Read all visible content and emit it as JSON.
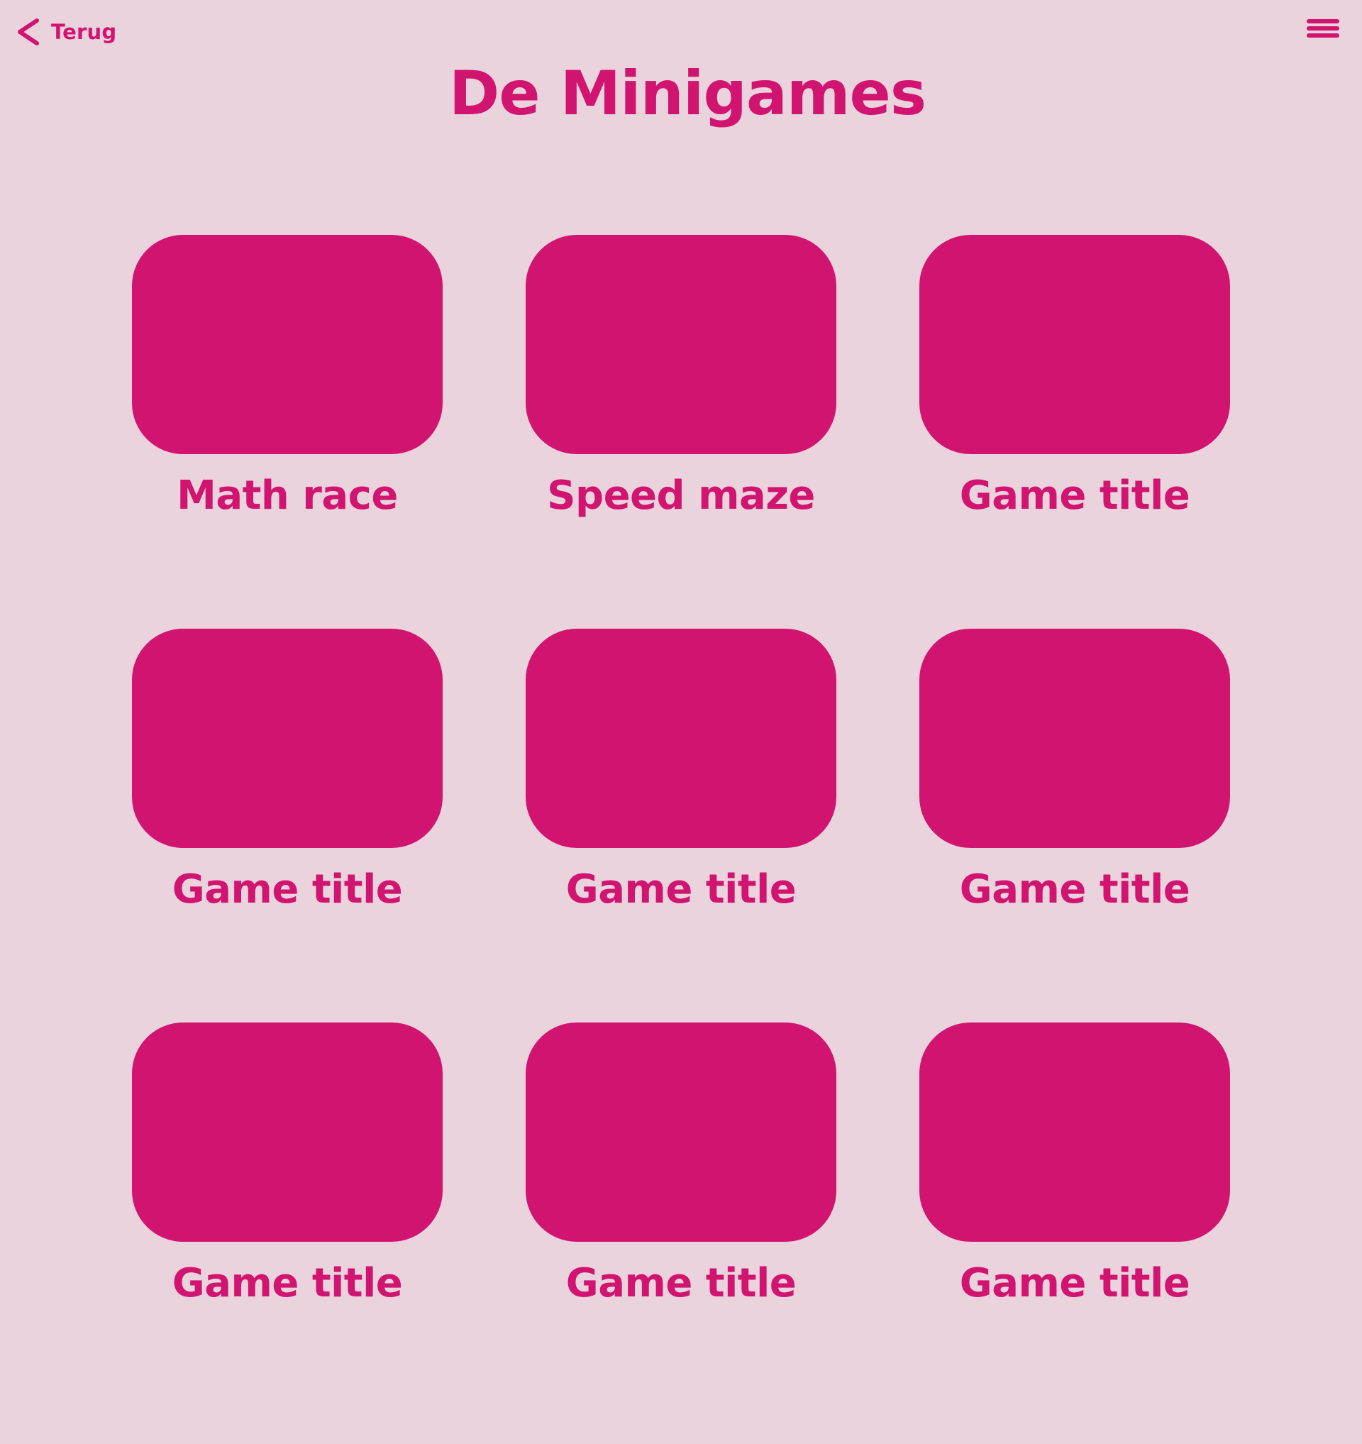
{
  "header": {
    "back_label": "Terug",
    "back_icon": "chevron-left-icon",
    "menu_icon": "hamburger-menu-icon",
    "title": "De Minigames"
  },
  "colors": {
    "background": "#ebd3de",
    "accent": "#d1146f"
  },
  "games": [
    {
      "title": "Math race"
    },
    {
      "title": "Speed maze"
    },
    {
      "title": "Game title"
    },
    {
      "title": "Game title"
    },
    {
      "title": "Game title"
    },
    {
      "title": "Game title"
    },
    {
      "title": "Game title"
    },
    {
      "title": "Game title"
    },
    {
      "title": "Game title"
    }
  ]
}
